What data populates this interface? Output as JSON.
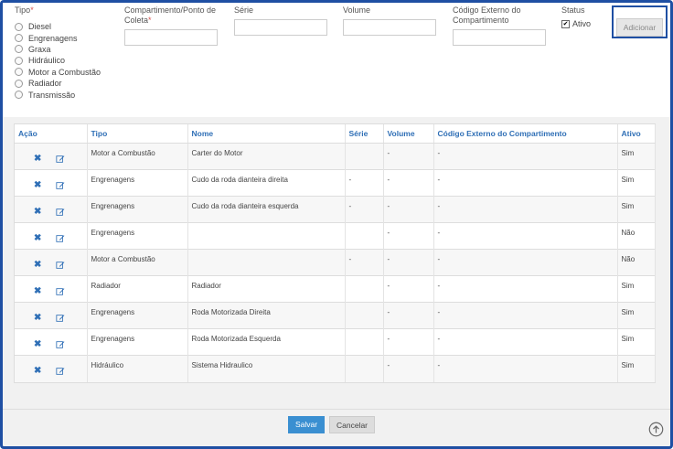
{
  "form": {
    "tipo_label": "Tipo",
    "required_mark": "*",
    "tipo_options": [
      "Diesel",
      "Engrenagens",
      "Graxa",
      "Hidráulico",
      "Motor a Combustão",
      "Radiador",
      "Transmissão"
    ],
    "compartimento_label_line1": "Compartimento/Ponto de",
    "compartimento_label_line2": "Coleta",
    "serie_label": "Série",
    "volume_label": "Volume",
    "codigo_label_line1": "Código Externo do",
    "codigo_label_line2": "Compartimento",
    "status_label": "Status",
    "ativo_label": "Ativo",
    "ativo_checked": true,
    "add_button": "Adicionar"
  },
  "table": {
    "headers": [
      "Ação",
      "Tipo",
      "Nome",
      "Série",
      "Volume",
      "Código Externo do Compartimento",
      "Ativo"
    ],
    "rows": [
      {
        "tipo": "Motor a Combustão",
        "nome": "Carter do Motor",
        "serie": "",
        "volume": "-",
        "codigo": "-",
        "ativo": "Sim"
      },
      {
        "tipo": "Engrenagens",
        "nome": "Cudo da roda dianteira direita",
        "serie": "-",
        "volume": "-",
        "codigo": "-",
        "ativo": "Sim"
      },
      {
        "tipo": "Engrenagens",
        "nome": "Cudo da roda dianteira esquerda",
        "serie": "-",
        "volume": "-",
        "codigo": "-",
        "ativo": "Sim"
      },
      {
        "tipo": "Engrenagens",
        "nome": "",
        "serie": "",
        "volume": "-",
        "codigo": "-",
        "ativo": "Não"
      },
      {
        "tipo": "Motor a Combustão",
        "nome": "",
        "serie": "-",
        "volume": "-",
        "codigo": "-",
        "ativo": "Não"
      },
      {
        "tipo": "Radiador",
        "nome": "Radiador",
        "serie": "",
        "volume": "-",
        "codigo": "-",
        "ativo": "Sim"
      },
      {
        "tipo": "Engrenagens",
        "nome": "Roda Motorizada Direita",
        "serie": "",
        "volume": "-",
        "codigo": "-",
        "ativo": "Sim"
      },
      {
        "tipo": "Engrenagens",
        "nome": "Roda Motorizada Esquerda",
        "serie": "",
        "volume": "-",
        "codigo": "-",
        "ativo": "Sim"
      },
      {
        "tipo": "Hidráulico",
        "nome": "Sistema Hidraulico",
        "serie": "",
        "volume": "-",
        "codigo": "-",
        "ativo": "Sim"
      }
    ]
  },
  "footer": {
    "save_label": "Salvar",
    "cancel_label": "Cancelar"
  },
  "colors": {
    "accent": "#2f6fb6",
    "frame_border": "#1f4fa3",
    "save_button": "#3a8fd1"
  },
  "icons": {
    "delete": "close-icon",
    "edit": "edit-icon",
    "scroll_top": "arrow-up-circle-icon"
  }
}
